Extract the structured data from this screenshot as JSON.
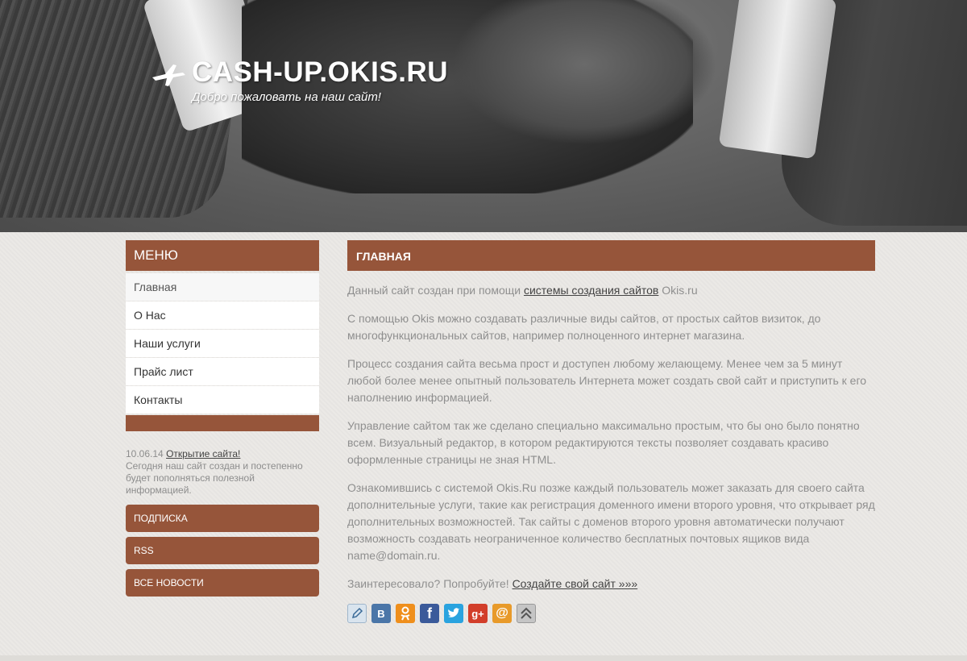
{
  "header": {
    "title": "CASH-UP.OKIS.RU",
    "subtitle": "Добро пожаловать на наш сайт!",
    "logo_icon": "airplane-icon"
  },
  "sidebar": {
    "menu_title": "Меню",
    "items": [
      {
        "label": "Главная"
      },
      {
        "label": "О Нас"
      },
      {
        "label": "Наши услуги"
      },
      {
        "label": "Прайс лист"
      },
      {
        "label": "Контакты"
      }
    ],
    "news": {
      "date": "10.06.14",
      "link": "Открытие сайта!",
      "text": "Сегодня наш сайт создан и постепенно будет пополняться полезной информацией."
    },
    "buttons": [
      {
        "label": "Подписка"
      },
      {
        "label": "RSS"
      },
      {
        "label": "Все новости"
      }
    ]
  },
  "content": {
    "title": "Главная",
    "p1": {
      "before": "Данный сайт создан при помощи ",
      "link": "системы создания сайтов",
      "after": " Okis.ru"
    },
    "p2": "С помощью Okis можно создавать различные виды сайтов, от простых сайтов визиток, до многофункциональных сайтов, например полноценного интернет магазина.",
    "p3": "Процесс создания сайта весьма прост и доступен любому желающему. Менее чем за 5 минут любой более менее опытный пользователь Интернета может создать свой сайт и приступить к его наполнению информацией.",
    "p4": "Управление сайтом так же сделано специально максимально простым, что бы оно было понятно всем. Визуальный редактор, в котором редактируются тексты позволяет создавать красиво оформленные страницы не зная HTML.",
    "p5": "Ознакомившись с системой Okis.Ru позже каждый пользователь может заказать для своего сайта дополнительные услуги, такие как регистрация доменного имени второго уровня, что открывает ряд дополнительных возможностей. Так сайты с доменов второго уровня автоматически получают возможность создавать неограниченное количество бесплатных почтовых ящиков вида name@domain.ru.",
    "p6": {
      "before": "Заинтересовало? Попробуйте! ",
      "link": "Создайте свой сайт »»»"
    }
  },
  "share": {
    "icons": [
      "livejournal-icon",
      "vkontakte-icon",
      "odnoklassniki-icon",
      "facebook-icon",
      "twitter-icon",
      "google-plus-icon",
      "mail-ru-icon",
      "more-share-icon"
    ],
    "vk_letter": "B",
    "fb_letter": "f",
    "gplus_text": "g+",
    "mail_glyph": "@",
    "colors": {
      "lj": "#d9e4ee",
      "vk": "#4b76a8",
      "ok": "#ef8f1c",
      "fb": "#3b5a9a",
      "tw": "#2aa3df",
      "gp": "#d23e2a",
      "mr": "#e89a2a",
      "more": "#c5c5c5"
    }
  },
  "colors": {
    "accent": "#96553a",
    "background": "#ebe9e6",
    "text": "#8f8f8f"
  }
}
